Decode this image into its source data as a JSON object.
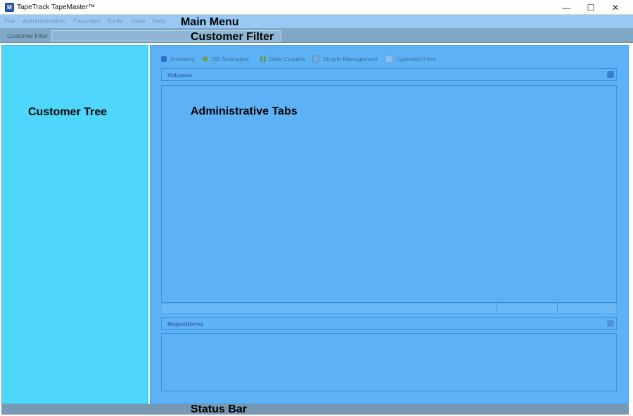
{
  "window": {
    "title": "TapeTrack TapeMaster™",
    "logo_letter": "M",
    "minimize_glyph": "—",
    "maximize_glyph": "☐",
    "close_glyph": "✕"
  },
  "menu": {
    "items": [
      "File",
      "Administration",
      "Favorites",
      "Tools",
      "View",
      "Help"
    ]
  },
  "customer_filter": {
    "label": "Customer Filter",
    "value": ""
  },
  "tabs": [
    {
      "label": "Inventory",
      "icon": "inventory-icon"
    },
    {
      "label": "DR Strategies",
      "icon": "dr-strategies-icon"
    },
    {
      "label": "Data Clusters",
      "icon": "data-clusters-icon"
    },
    {
      "label": "Simple Management",
      "icon": "simple-management-icon"
    },
    {
      "label": "Uploaded Files",
      "icon": "uploaded-files-icon"
    }
  ],
  "panels": {
    "volumes_title": "Volumes",
    "repositories_title": "Repositories"
  },
  "overlays": {
    "main_menu": "Main Menu",
    "customer_filter": "Customer Filter",
    "customer_tree": "Customer Tree",
    "administrative_tabs": "Administrative Tabs",
    "status_bar": "Status Bar"
  },
  "colors": {
    "menu_bar": "#98c8f4",
    "filter_bar": "#7fa8c7",
    "customer_tree": "#4ed6fb",
    "admin_area": "#5db2f5",
    "status_bar": "#7899b4"
  }
}
